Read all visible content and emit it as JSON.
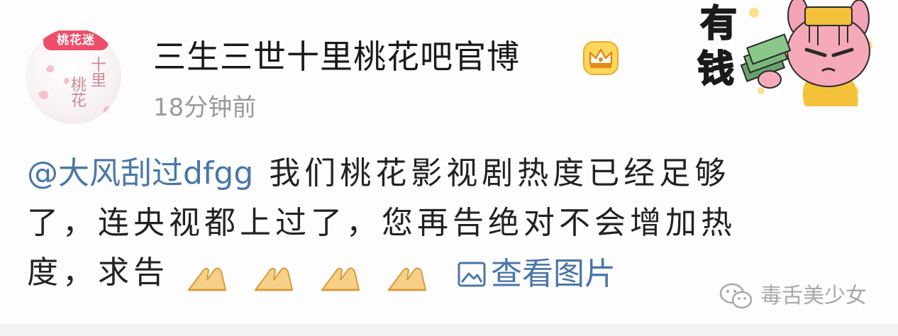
{
  "post": {
    "author": {
      "name": "三生三世十里桃花吧官博",
      "avatar_badge": "桃花迷",
      "avatar_text": [
        "十里",
        "桃花"
      ],
      "verified_icon": "crown-icon"
    },
    "timestamp": "18分钟前",
    "sticker": {
      "text_top": "有",
      "text_bottom": "钱",
      "icon": "rich-bunny-sticker"
    },
    "content": {
      "mention": "@大风刮过dfgg",
      "line1_text": "我们桃花影视剧热度已经足够",
      "line2_text": "了，连央视都上过了，您再告绝对不会增加热",
      "line3_text": "度，求告",
      "emoji": [
        "praying-hands-emoji",
        "praying-hands-emoji",
        "praying-hands-emoji",
        "praying-hands-emoji"
      ],
      "view_image_label": "查看图片",
      "view_image_icon": "image-icon"
    }
  },
  "watermark": {
    "icon": "wechat-icon",
    "text": "毒舌美少女"
  },
  "colors": {
    "link": "#4a76a8",
    "text": "#222222",
    "muted": "#9a9a9a"
  }
}
